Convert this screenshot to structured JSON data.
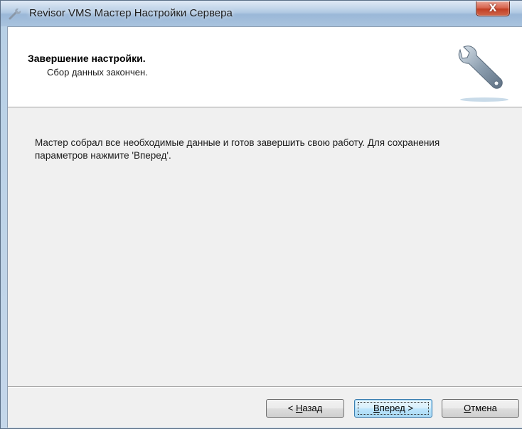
{
  "window": {
    "title": "Revisor VMS Мастер Настройки Сервера",
    "close_glyph": "X"
  },
  "header": {
    "title": "Завершение настройки.",
    "subtitle": "Сбор данных закончен.",
    "icon": "wrench-icon"
  },
  "content": {
    "message": "Мастер собрал все необходимые данные и готов завершить свою работу. Для сохранения параметров нажмите 'Вперед'."
  },
  "buttons": {
    "back": {
      "prefix": "< ",
      "mnemonic": "Н",
      "rest": "азад"
    },
    "next": {
      "prefix": "",
      "mnemonic": "В",
      "rest": "перед >"
    },
    "cancel": {
      "prefix": "",
      "mnemonic": "О",
      "rest": "тмена"
    }
  },
  "colors": {
    "title_bar": "#aac4e0",
    "close_button": "#c13d22",
    "default_button_border": "#3c7fb1",
    "dialog_background": "#f0f0f0"
  }
}
